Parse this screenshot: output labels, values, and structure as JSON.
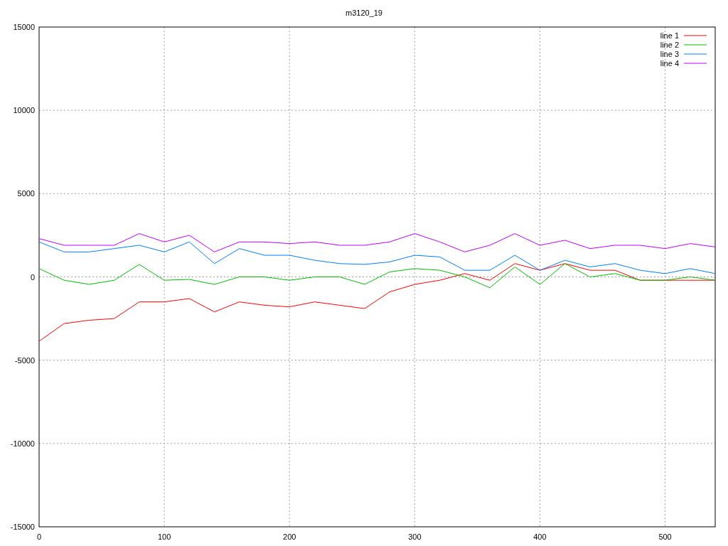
{
  "chart": {
    "chart_data": {
      "type": "line",
      "title": "m3120_19",
      "x": [
        0,
        20,
        40,
        60,
        80,
        100,
        120,
        140,
        160,
        180,
        200,
        220,
        240,
        260,
        280,
        300,
        320,
        340,
        360,
        380,
        400,
        420,
        440,
        460,
        480,
        500,
        520,
        540
      ],
      "series": [
        {
          "name": "line 1",
          "color": "#ff0000",
          "values": [
            -3860,
            -2800,
            -2600,
            -2500,
            -1500,
            -1500,
            -1300,
            -2100,
            -1500,
            -1700,
            -1800,
            -1500,
            -1700,
            -1900,
            -900,
            -450,
            -200,
            200,
            -200,
            800,
            400,
            800,
            400,
            400,
            -200,
            -200,
            -200,
            -200
          ]
        },
        {
          "name": "line 2",
          "color": "#00c000",
          "values": [
            500,
            -200,
            -450,
            -200,
            750,
            -200,
            -150,
            -450,
            0,
            0,
            -200,
            0,
            0,
            -450,
            300,
            500,
            400,
            0,
            -650,
            600,
            -450,
            800,
            0,
            200,
            -200,
            -200,
            0,
            -200
          ]
        },
        {
          "name": "line 3",
          "color": "#0080ff",
          "values": [
            2100,
            1500,
            1500,
            1700,
            1900,
            1500,
            2100,
            800,
            1700,
            1300,
            1300,
            1000,
            800,
            750,
            900,
            1300,
            1200,
            400,
            400,
            1300,
            400,
            1000,
            600,
            800,
            400,
            200,
            500,
            200
          ]
        },
        {
          "name": "line 4",
          "color": "#c000ff",
          "values": [
            2300,
            1900,
            1900,
            1900,
            2600,
            2100,
            2500,
            1500,
            2100,
            2100,
            2000,
            2100,
            1900,
            1900,
            2100,
            2600,
            2100,
            1500,
            1900,
            2600,
            1900,
            2200,
            1700,
            1900,
            1900,
            1700,
            2000,
            1800
          ]
        }
      ],
      "xlim": [
        0,
        540
      ],
      "ylim": [
        -15000,
        15000
      ],
      "xticks": [
        0,
        100,
        200,
        300,
        400,
        500
      ],
      "yticks": [
        -15000,
        -10000,
        -5000,
        0,
        5000,
        10000,
        15000
      ],
      "grid": true,
      "legend": true
    }
  }
}
